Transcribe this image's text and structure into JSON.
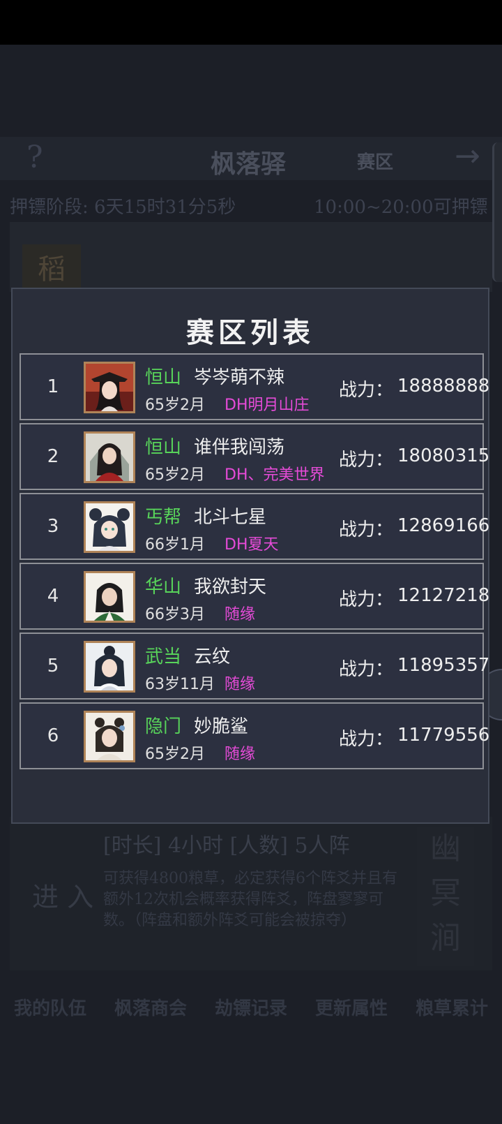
{
  "background": {
    "help_icon": "?",
    "location": "枫落驿",
    "zone_label": "赛区",
    "arrow_icon": "→",
    "stage_label": "押镖阶段: 6天15时31分5秒",
    "time_window": "10:00~20:00可押镖",
    "card_top_tag": "稻",
    "card_duration": "[时长] 4小时   [人数] 5人阵",
    "card_enter": "进 入",
    "card_desc": "可获得4800粮草，必定获得6个阵爻并且有额外12次机会概率获得阵爻，阵盘寥寥可数。（阵盘和额外阵爻可能会被掠夺）",
    "card_side": "幽冥涧",
    "nav": [
      "我的队伍",
      "枫落商会",
      "劫镖记录",
      "更新属性",
      "粮草累计"
    ]
  },
  "dialog": {
    "title": "赛区列表",
    "power_label": "战力：",
    "rows": [
      {
        "rank": "1",
        "school": "恒山",
        "name": "岑岑萌不辣",
        "age": "65岁2月",
        "guild": "DH明月山庄",
        "power": "18888888",
        "avatar_icon": "avatar-female-hat"
      },
      {
        "rank": "2",
        "school": "恒山",
        "name": "谁伴我闯荡",
        "age": "65岁2月",
        "guild": "DH、完美世界",
        "power": "18080315",
        "avatar_icon": "avatar-male-red"
      },
      {
        "rank": "3",
        "school": "丐帮",
        "name": "北斗七星",
        "age": "66岁1月",
        "guild": "DH夏天",
        "power": "12869166",
        "avatar_icon": "avatar-girl-buns"
      },
      {
        "rank": "4",
        "school": "华山",
        "name": "我欲封天",
        "age": "66岁3月",
        "guild": "随缘",
        "power": "12127218",
        "avatar_icon": "avatar-male-green"
      },
      {
        "rank": "5",
        "school": "武当",
        "name": "云纹",
        "age": "63岁11月",
        "guild": "随缘",
        "power": "11895357",
        "avatar_icon": "avatar-female-white"
      },
      {
        "rank": "6",
        "school": "隐门",
        "name": "妙脆鲨",
        "age": "65岁2月",
        "guild": "随缘",
        "power": "11779556",
        "avatar_icon": "avatar-female-flower"
      }
    ]
  },
  "colors": {
    "school": "#58d45a",
    "guild": "#e64bd8",
    "avatar_border": "#b08458",
    "row_border": "#8e9096"
  }
}
